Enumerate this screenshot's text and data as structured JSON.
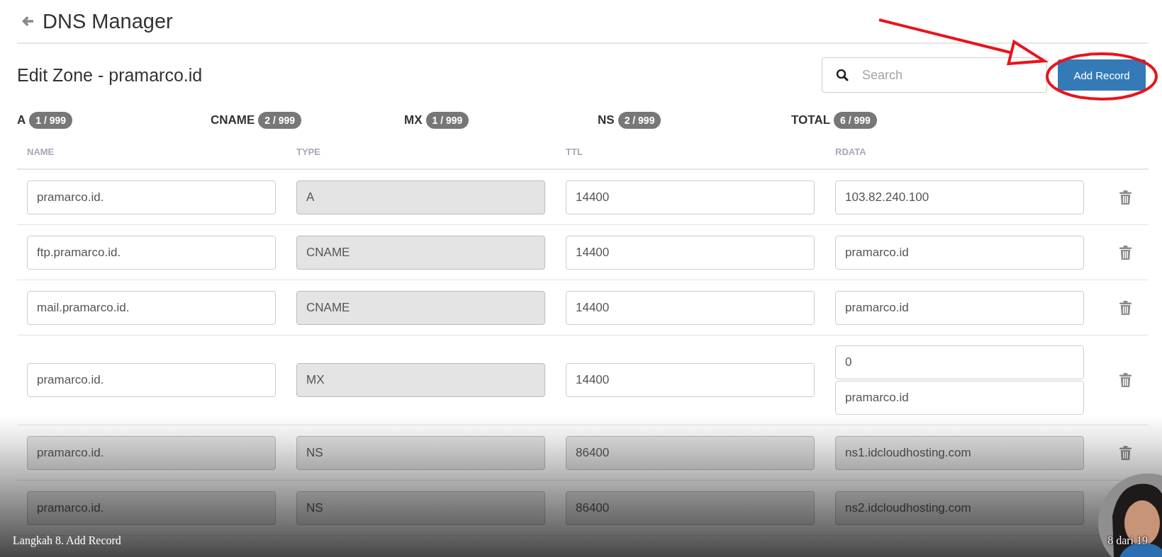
{
  "header": {
    "title": "DNS Manager"
  },
  "zone": {
    "title": "Edit Zone - pramarco.id"
  },
  "search": {
    "placeholder": "Search"
  },
  "add_button": {
    "label": "Add Record"
  },
  "counts": [
    {
      "label": "A",
      "count": "1 / 999"
    },
    {
      "label": "CNAME",
      "count": "2 / 999"
    },
    {
      "label": "MX",
      "count": "1 / 999"
    },
    {
      "label": "NS",
      "count": "2 / 999"
    },
    {
      "label": "TOTAL",
      "count": "6 / 999"
    }
  ],
  "columns": [
    "NAME",
    "TYPE",
    "TTL",
    "RDATA"
  ],
  "records": [
    {
      "delete_icon": true,
      "cells": [
        {
          "values": [
            "pramarco.id."
          ],
          "disabled": false
        },
        {
          "values": [
            "A"
          ],
          "disabled": true
        },
        {
          "values": [
            "14400"
          ],
          "disabled": false
        },
        {
          "values": [
            "103.82.240.100"
          ],
          "disabled": false
        }
      ]
    },
    {
      "delete_icon": true,
      "cells": [
        {
          "values": [
            "ftp.pramarco.id."
          ],
          "disabled": false
        },
        {
          "values": [
            "CNAME"
          ],
          "disabled": true
        },
        {
          "values": [
            "14400"
          ],
          "disabled": false
        },
        {
          "values": [
            "pramarco.id"
          ],
          "disabled": false
        }
      ]
    },
    {
      "delete_icon": true,
      "cells": [
        {
          "values": [
            "mail.pramarco.id."
          ],
          "disabled": false
        },
        {
          "values": [
            "CNAME"
          ],
          "disabled": true
        },
        {
          "values": [
            "14400"
          ],
          "disabled": false
        },
        {
          "values": [
            "pramarco.id"
          ],
          "disabled": false
        }
      ]
    },
    {
      "delete_icon": true,
      "cells": [
        {
          "values": [
            "pramarco.id."
          ],
          "disabled": false
        },
        {
          "values": [
            "MX"
          ],
          "disabled": true
        },
        {
          "values": [
            "14400"
          ],
          "disabled": false
        },
        {
          "values": [
            "0",
            "pramarco.id"
          ],
          "disabled": false
        }
      ]
    },
    {
      "delete_icon": true,
      "cells": [
        {
          "values": [
            "pramarco.id."
          ],
          "disabled": true
        },
        {
          "values": [
            "NS"
          ],
          "disabled": true
        },
        {
          "values": [
            "86400"
          ],
          "disabled": true
        },
        {
          "values": [
            "ns1.idcloudhosting.com"
          ],
          "disabled": true
        }
      ]
    },
    {
      "delete_icon": false,
      "cells": [
        {
          "values": [
            "pramarco.id."
          ],
          "disabled": true
        },
        {
          "values": [
            "NS"
          ],
          "disabled": true
        },
        {
          "values": [
            "86400"
          ],
          "disabled": true
        },
        {
          "values": [
            "ns2.idcloudhosting.com"
          ],
          "disabled": true
        }
      ]
    }
  ],
  "annotations": [
    {
      "kind": "arrow"
    },
    {
      "kind": "ellipse"
    }
  ],
  "footer": {
    "caption": "Langkah 8. Add Record",
    "page": "8 dari 19"
  },
  "presenter": {
    "kind": "picture"
  }
}
